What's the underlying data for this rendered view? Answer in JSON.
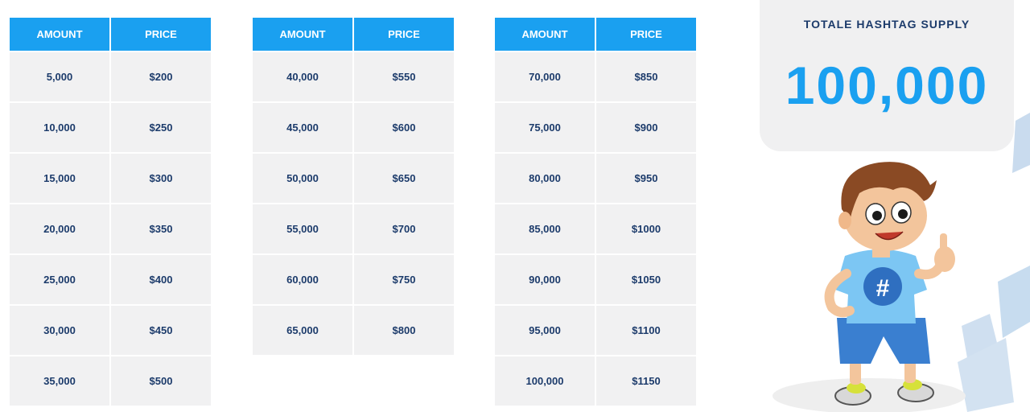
{
  "tables": [
    {
      "headers": [
        "AMOUNT",
        "PRICE"
      ],
      "rows": [
        [
          "5,000",
          "$200"
        ],
        [
          "10,000",
          "$250"
        ],
        [
          "15,000",
          "$300"
        ],
        [
          "20,000",
          "$350"
        ],
        [
          "25,000",
          "$400"
        ],
        [
          "30,000",
          "$450"
        ],
        [
          "35,000",
          "$500"
        ]
      ]
    },
    {
      "headers": [
        "AMOUNT",
        "PRICE"
      ],
      "rows": [
        [
          "40,000",
          "$550"
        ],
        [
          "45,000",
          "$600"
        ],
        [
          "50,000",
          "$650"
        ],
        [
          "55,000",
          "$700"
        ],
        [
          "60,000",
          "$750"
        ],
        [
          "65,000",
          "$800"
        ]
      ]
    },
    {
      "headers": [
        "AMOUNT",
        "PRICE"
      ],
      "rows": [
        [
          "70,000",
          "$850"
        ],
        [
          "75,000",
          "$900"
        ],
        [
          "80,000",
          "$950"
        ],
        [
          "85,000",
          "$1000"
        ],
        [
          "90,000",
          "$1050"
        ],
        [
          "95,000",
          "$1100"
        ],
        [
          "100,000",
          "$1150"
        ]
      ]
    }
  ],
  "supply": {
    "title": "TOTALE  HASHTAG SUPPLY",
    "value": "100,000"
  },
  "mascot": {
    "icon": "hashtag-mascot-boy-thumbs-up",
    "shirt_symbol": "#"
  },
  "colors": {
    "header_blue": "#1aa0f0",
    "cell_grey": "#f1f1f2",
    "text_navy": "#1c3b6b",
    "card_grey": "#f0f0f1"
  }
}
